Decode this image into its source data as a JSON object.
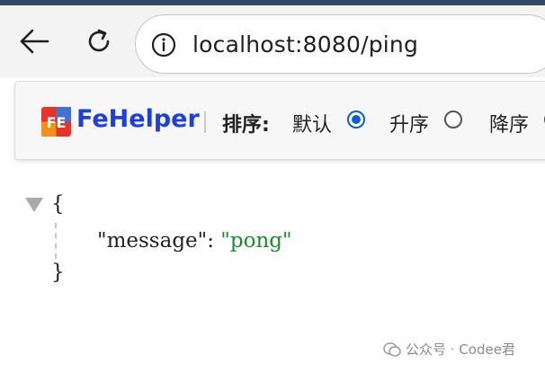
{
  "browser": {
    "url": "localhost:8080/ping"
  },
  "fehelper": {
    "logo_text": "FE",
    "title": "FeHelper",
    "sort_label": "排序:",
    "options": [
      {
        "label": "默认",
        "checked": true
      },
      {
        "label": "升序",
        "checked": false
      },
      {
        "label": "降序",
        "checked": false
      }
    ]
  },
  "json": {
    "open_brace": "{",
    "close_brace": "}",
    "key": "\"message\"",
    "colon": ": ",
    "value": "\"pong\""
  },
  "watermark": {
    "text": "公众号 · Codee君"
  },
  "colors": {
    "accent": "#0d5fd1",
    "fehelper_title": "#1e3fdc",
    "json_string": "#1f8a2c"
  }
}
